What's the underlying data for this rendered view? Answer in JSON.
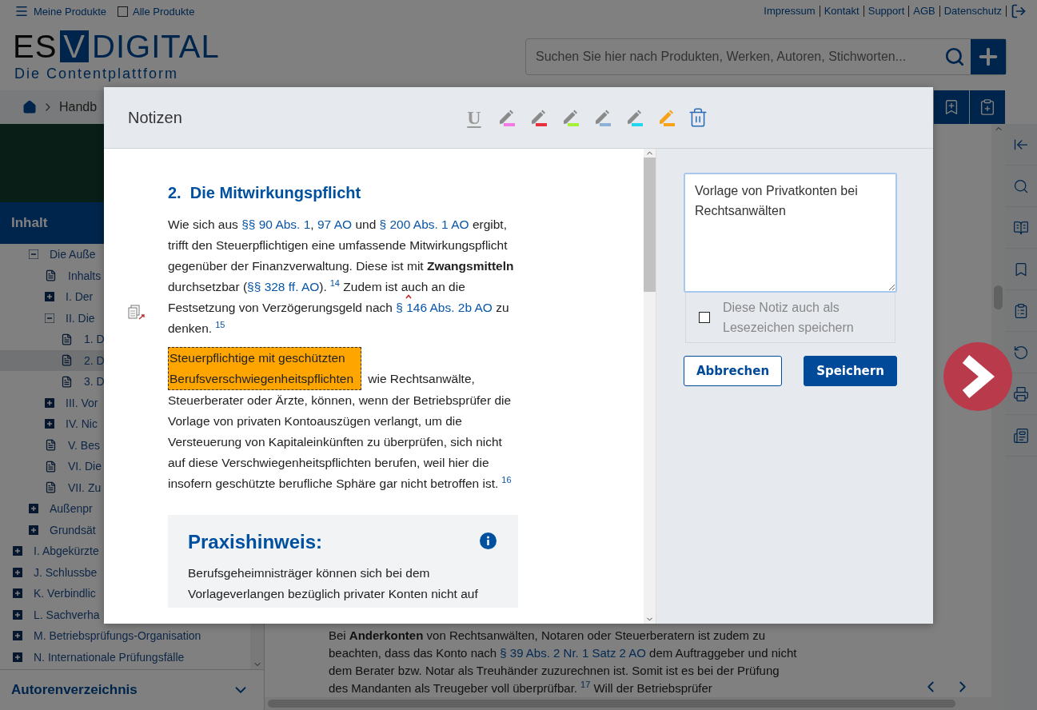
{
  "top_bar": {
    "menu_label": "Meine Produkte",
    "all_products": {
      "label": "Alle Produkte",
      "checked": false
    },
    "links": [
      "Impressum",
      "Kontakt",
      "Support",
      "AGB",
      "Datenschutz"
    ]
  },
  "logo": {
    "left": "ES",
    "boxed": "V",
    "right": "DIGITAL",
    "tagline": "Die Contentplattform"
  },
  "search": {
    "placeholder": "Suchen Sie hier nach Produkten, Werken, Autoren, Stichworten..."
  },
  "breadcrumb": [
    "Handb"
  ],
  "sidebar": {
    "title": "Inhalt",
    "tree": [
      {
        "children": [
          {
            "label": "Die Auße",
            "kind": "section",
            "expanded": true,
            "selected": false,
            "children": [
              {
                "label": "Inhalts",
                "kind": "document",
                "selected": false
              },
              {
                "label": "I. Der",
                "kind": "section",
                "expanded": false,
                "selected": false
              },
              {
                "label": "II. Die",
                "kind": "section",
                "expanded": true,
                "selected": false,
                "children": [
                  {
                    "label": "1. D",
                    "kind": "document",
                    "selected": false
                  },
                  {
                    "label": "2. D",
                    "kind": "document",
                    "selected": true
                  },
                  {
                    "label": "3. D",
                    "kind": "document",
                    "selected": false
                  }
                ]
              },
              {
                "label": "III. Vor",
                "kind": "section",
                "expanded": false,
                "selected": false
              },
              {
                "label": "IV. Nic",
                "kind": "section",
                "expanded": false,
                "selected": false
              },
              {
                "label": "V. Bes",
                "kind": "document",
                "selected": false
              },
              {
                "label": "VI. Die",
                "kind": "document",
                "selected": false
              },
              {
                "label": "VII. Zu",
                "kind": "document",
                "selected": false
              }
            ]
          },
          {
            "label": "Außenpr",
            "kind": "section",
            "expanded": false,
            "selected": false
          },
          {
            "label": "Grundsät",
            "kind": "section",
            "expanded": false,
            "selected": false
          }
        ]
      },
      {
        "label": "I. Abgekürzte",
        "kind": "section",
        "expanded": false,
        "selected": false
      },
      {
        "label": "J. Schlussbe",
        "kind": "section",
        "expanded": false,
        "selected": false
      },
      {
        "label": "K. Verbindlic",
        "kind": "section",
        "expanded": false,
        "selected": false
      },
      {
        "label": "L. Sachverha",
        "kind": "section",
        "expanded": false,
        "selected": false
      },
      {
        "label": "M. Betriebsprüfungs-Organisation",
        "kind": "section",
        "expanded": false,
        "selected": false
      },
      {
        "label": "N. Internationale Prüfungsfälle",
        "kind": "section",
        "expanded": false,
        "selected": false
      }
    ],
    "footer": "Autorenverzeichnis"
  },
  "content": {
    "runs": [
      {
        "kind": "text",
        "text": "Bei **Anderkonten** von Rechtsanwälten, Notaren oder Steuerberatern ist zudem zu beachten, dass das Konto nach "
      },
      {
        "kind": "link",
        "text": "§ 39 Abs. 2 Nr. 1 Satz 2 AO"
      },
      {
        "kind": "text",
        "text": " dem Auftraggeber und nicht dem Berater bzw. Notar als Treuhänder zuzurechnen ist. Somit ist es bei der Prüfung des Mandanten als Treugeber voll überprüfbar."
      },
      {
        "kind": "footnote",
        "text": "17"
      },
      {
        "kind": "text",
        "text": " Will der Betriebsprüfer"
      }
    ]
  },
  "dialog": {
    "title": "Notizen",
    "underline_tool": "U",
    "pens": [
      {
        "color": "#f27ae6",
        "selected": false
      },
      {
        "color": "#e8313c",
        "selected": false
      },
      {
        "color": "#a6f03a",
        "selected": false
      },
      {
        "color": "#8fb0d6",
        "selected": false
      },
      {
        "color": "#22d6ee",
        "selected": false
      },
      {
        "color": "#f7a21b",
        "selected": true
      }
    ],
    "heading": "2.  Die Mitwirkungspflicht",
    "paragraphs": [
      [
        {
          "kind": "text",
          "text": "Wie sich aus "
        },
        {
          "kind": "link",
          "text": "§§ 90 Abs. 1"
        },
        {
          "kind": "text",
          "text": ", "
        },
        {
          "kind": "link",
          "text": "97 AO"
        },
        {
          "kind": "text",
          "text": " und "
        },
        {
          "kind": "link",
          "text": "§ 200 Abs. 1 AO"
        },
        {
          "kind": "text",
          "text": " ergibt, trifft den Steuerpflichtigen eine umfassende Mitwirkungspflicht gegenüber der Finanzverwaltung. Diese ist mit **Zwangsmitteln** durchsetzbar ("
        },
        {
          "kind": "link",
          "text": "§§ 328 ff. AO"
        },
        {
          "kind": "text",
          "text": ")."
        },
        {
          "kind": "footnote",
          "text": "14"
        },
        {
          "kind": "text",
          "text": " Zudem ist auch an die Festsetzung von Verzögerungsgeld nach "
        },
        {
          "kind": "marker"
        },
        {
          "kind": "link",
          "text": "§ 146 Abs. 2b AO"
        },
        {
          "kind": "text",
          "text": " zu denken."
        },
        {
          "kind": "footnote",
          "text": "15"
        }
      ],
      [
        {
          "kind": "highlight",
          "color": "#ffa500",
          "text": "Steuerpflichtige mit geschützten Berufsverschwiegenheitspflichten"
        },
        {
          "kind": "text",
          "text": " wie Rechtsanwälte, Steuerberater oder Ärzte, können, wenn der Betriebsprüfer die Vorlage von privaten Kontoauszügen verlangt, um die Versteuerung von Kapitaleinkünften zu überprüfen, sich nicht auf diese Verschwiegenheitspflichten berufen, weil hier die insofern geschützte berufliche Sphäre gar nicht betroffen ist."
        },
        {
          "kind": "footnote",
          "text": "16"
        }
      ]
    ],
    "hint": {
      "title": "Praxishinweis:",
      "text": "Berufsgeheimnisträger können sich bei dem Vorlageverlangen bezüglich privater Konten nicht auf"
    },
    "note": {
      "value": "Vorlage von Privatkonten bei Rechtsanwälten",
      "bookmark": {
        "label": "Diese Notiz auch als Lesezeichen speichern",
        "checked": false
      },
      "buttons": [
        {
          "label": "Abbrechen",
          "kind": "secondary"
        },
        {
          "label": "Speichern",
          "kind": "primary"
        }
      ]
    }
  }
}
